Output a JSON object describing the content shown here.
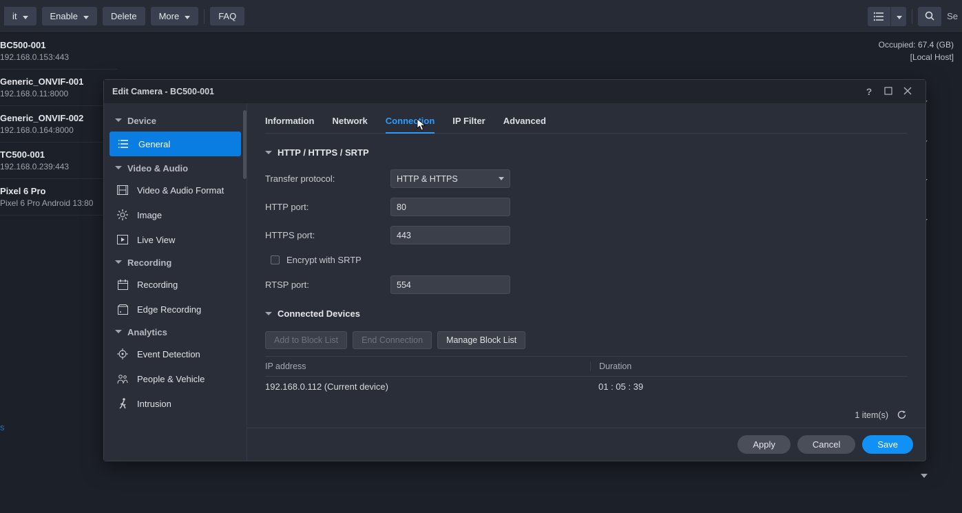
{
  "toolbar": {
    "edit": "it",
    "enable": "Enable",
    "delete": "Delete",
    "more": "More",
    "faq": "FAQ",
    "search_placeholder": "Se"
  },
  "header_right": {
    "occupied": "Occupied: 67.4 (GB)",
    "host": "[Local Host]"
  },
  "cameras": [
    {
      "name": "BC500-001",
      "addr": "192.168.0.153:443"
    },
    {
      "name": "Generic_ONVIF-001",
      "addr": "192.168.0.11:8000"
    },
    {
      "name": "Generic_ONVIF-002",
      "addr": "192.168.0.164:8000"
    },
    {
      "name": "TC500-001",
      "addr": "192.168.0.239:443"
    },
    {
      "name": "Pixel 6 Pro",
      "addr": "Pixel 6 Pro Android 13:80"
    }
  ],
  "deactivated_label": "s",
  "dialog": {
    "title": "Edit Camera - BC500-001",
    "sidebar": {
      "groups": {
        "device": "Device",
        "video_audio": "Video & Audio",
        "recording": "Recording",
        "analytics": "Analytics"
      },
      "items": {
        "general": "General",
        "va_format": "Video & Audio Format",
        "image": "Image",
        "live_view": "Live View",
        "recording": "Recording",
        "edge_recording": "Edge Recording",
        "event_detection": "Event Detection",
        "people_vehicle": "People & Vehicle",
        "intrusion": "Intrusion"
      }
    },
    "tabs": {
      "information": "Information",
      "network": "Network",
      "connection": "Connection",
      "ip_filter": "IP Filter",
      "advanced": "Advanced"
    },
    "sections": {
      "http": "HTTP / HTTPS / SRTP",
      "connected": "Connected Devices"
    },
    "form": {
      "transfer_protocol_label": "Transfer protocol:",
      "transfer_protocol_value": "HTTP & HTTPS",
      "http_port_label": "HTTP port:",
      "http_port_value": "80",
      "https_port_label": "HTTPS port:",
      "https_port_value": "443",
      "encrypt_srtp_label": "Encrypt with SRTP",
      "rtsp_port_label": "RTSP port:",
      "rtsp_port_value": "554"
    },
    "conn_buttons": {
      "add_block": "Add to Block List",
      "end_conn": "End Connection",
      "manage_block": "Manage Block List"
    },
    "table": {
      "col_ip": "IP address",
      "col_duration": "Duration",
      "rows": [
        {
          "ip": "192.168.0.112 (Current device)",
          "duration": "01 : 05 : 39"
        }
      ]
    },
    "item_count": "1 item(s)",
    "footer": {
      "apply": "Apply",
      "cancel": "Cancel",
      "save": "Save"
    }
  }
}
